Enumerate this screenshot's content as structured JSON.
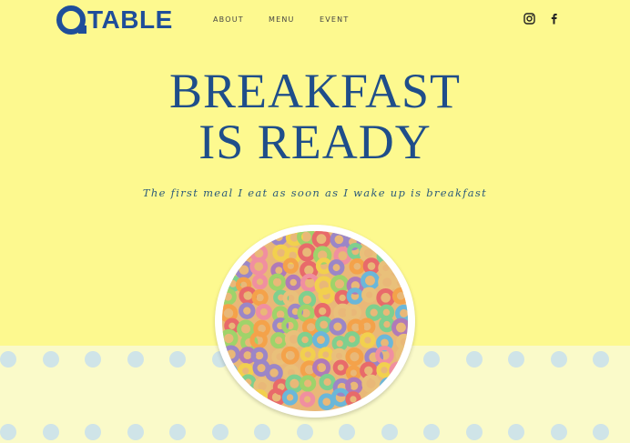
{
  "header": {
    "logo_text": "TABLE",
    "logo_icon": "circle-logo-icon",
    "nav": [
      {
        "label": "ABOUT"
      },
      {
        "label": "MENU"
      },
      {
        "label": "EVENT"
      }
    ],
    "social": [
      "instagram-icon",
      "facebook-icon"
    ]
  },
  "hero": {
    "title_line1": "BREAKFAST",
    "title_line2": "IS READY",
    "subtitle": "The first meal I eat as soon as I wake up is breakfast"
  },
  "image": {
    "subject": "bowl-of-fruit-loops-cereal"
  },
  "colors": {
    "background": "#fdf98f",
    "band": "#fafac9",
    "dots": "#cfe4e8",
    "brand": "#1f4e9a",
    "title": "#1f4e8a"
  }
}
